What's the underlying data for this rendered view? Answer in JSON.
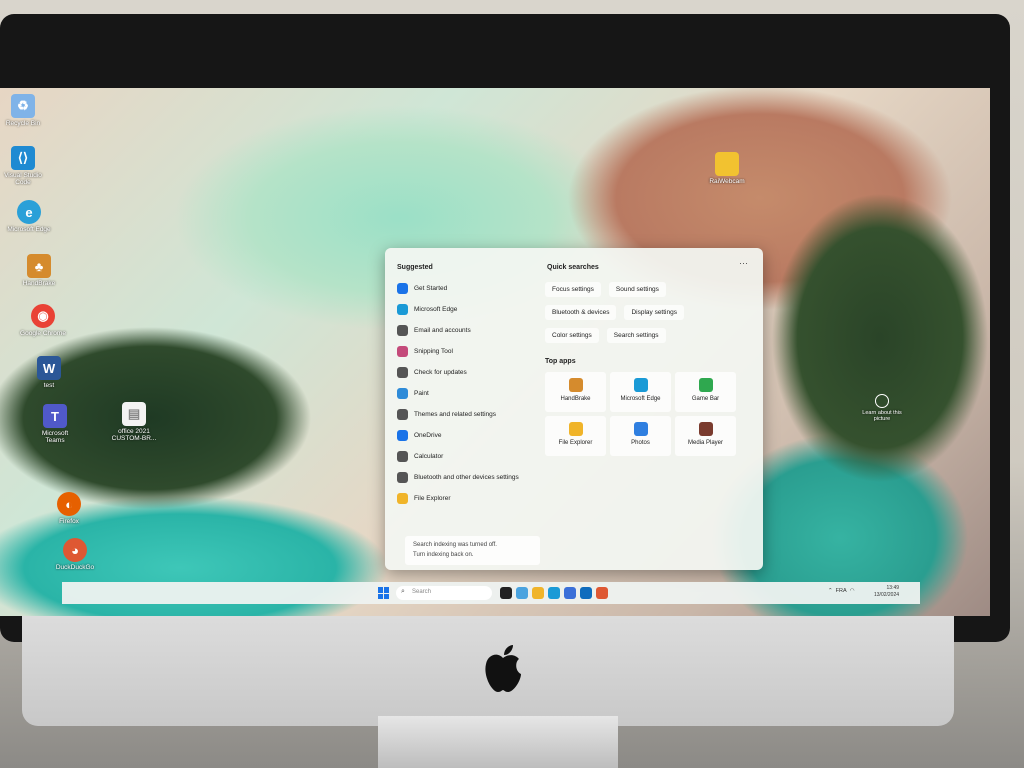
{
  "desktop": {
    "icons": [
      {
        "label": "Recycle Bin",
        "color": "#7fb3e8",
        "glyph": "♻"
      },
      {
        "label": "Visual Studio Code",
        "color": "#1f8ad2",
        "glyph": "⟨⟩"
      },
      {
        "label": "Microsoft Edge",
        "color": "#2aa0d8",
        "glyph": "e"
      },
      {
        "label": "HandBrake",
        "color": "#d58b2d",
        "glyph": "♣"
      },
      {
        "label": "Google Chrome",
        "color": "#e94235",
        "glyph": "◉"
      },
      {
        "label": "test",
        "color": "#2b5797",
        "glyph": "W"
      },
      {
        "label": "Microsoft Teams",
        "color": "#5059c9",
        "glyph": "T"
      },
      {
        "label": "office 2021 CUSTOM-BR...",
        "color": "#f3f3f3",
        "glyph": "▤"
      },
      {
        "label": "Firefox",
        "color": "#e66000",
        "glyph": "◐"
      },
      {
        "label": "DuckDuckGo",
        "color": "#de5833",
        "glyph": "◕"
      },
      {
        "label": "RaiWebcam",
        "color": "#f2c230",
        "glyph": "▬"
      }
    ],
    "learn_picture": "Learn about this picture"
  },
  "start_menu": {
    "suggested_title": "Suggested",
    "suggested": [
      {
        "label": "Get Started",
        "color": "#1a73e8",
        "icon": "get-started-icon"
      },
      {
        "label": "Microsoft Edge",
        "color": "#1a9ad6",
        "icon": "edge-icon"
      },
      {
        "label": "Email and accounts",
        "color": "#555555",
        "icon": "email-icon"
      },
      {
        "label": "Snipping Tool",
        "color": "#c44a7a",
        "icon": "snipping-tool-icon"
      },
      {
        "label": "Check for updates",
        "color": "#555555",
        "icon": "refresh-icon"
      },
      {
        "label": "Paint",
        "color": "#2e8bd8",
        "icon": "paint-icon"
      },
      {
        "label": "Themes and related settings",
        "color": "#555555",
        "icon": "brush-icon"
      },
      {
        "label": "OneDrive",
        "color": "#1a73e8",
        "icon": "onedrive-icon"
      },
      {
        "label": "Calculator",
        "color": "#555555",
        "icon": "calculator-icon"
      },
      {
        "label": "Bluetooth and other devices settings",
        "color": "#555555",
        "icon": "bluetooth-icon"
      },
      {
        "label": "File Explorer",
        "color": "#f0b429",
        "icon": "folder-icon"
      }
    ],
    "quick_title": "Quick searches",
    "quick_searches": [
      [
        "Focus settings",
        "Sound settings"
      ],
      [
        "Bluetooth & devices",
        "Display settings"
      ],
      [
        "Color settings",
        "Search settings"
      ]
    ],
    "top_apps_title": "Top apps",
    "top_apps": [
      {
        "label": "HandBrake",
        "color": "#d58b2d"
      },
      {
        "label": "Microsoft Edge",
        "color": "#1a9ad6"
      },
      {
        "label": "Game Bar",
        "color": "#2fa84f"
      },
      {
        "label": "File Explorer",
        "color": "#f0b429"
      },
      {
        "label": "Photos",
        "color": "#2f7fe0"
      },
      {
        "label": "Media Player",
        "color": "#7a3b2e"
      }
    ],
    "indexing_note_line1": "Search indexing was turned off.",
    "indexing_note_line2": "Turn indexing back on."
  },
  "taskbar": {
    "search_placeholder": "Search",
    "apps": [
      {
        "name": "taskview",
        "color": "#222222"
      },
      {
        "name": "widgets",
        "color": "#4aa3df"
      },
      {
        "name": "file-explorer",
        "color": "#f0b429"
      },
      {
        "name": "edge",
        "color": "#1a9ad6"
      },
      {
        "name": "store",
        "color": "#3a6fd8"
      },
      {
        "name": "outlook",
        "color": "#0f6cbd"
      },
      {
        "name": "duckduckgo",
        "color": "#de5833"
      }
    ],
    "tray_lang": "FRA",
    "time": "13:49",
    "date": "13/02/2024"
  }
}
